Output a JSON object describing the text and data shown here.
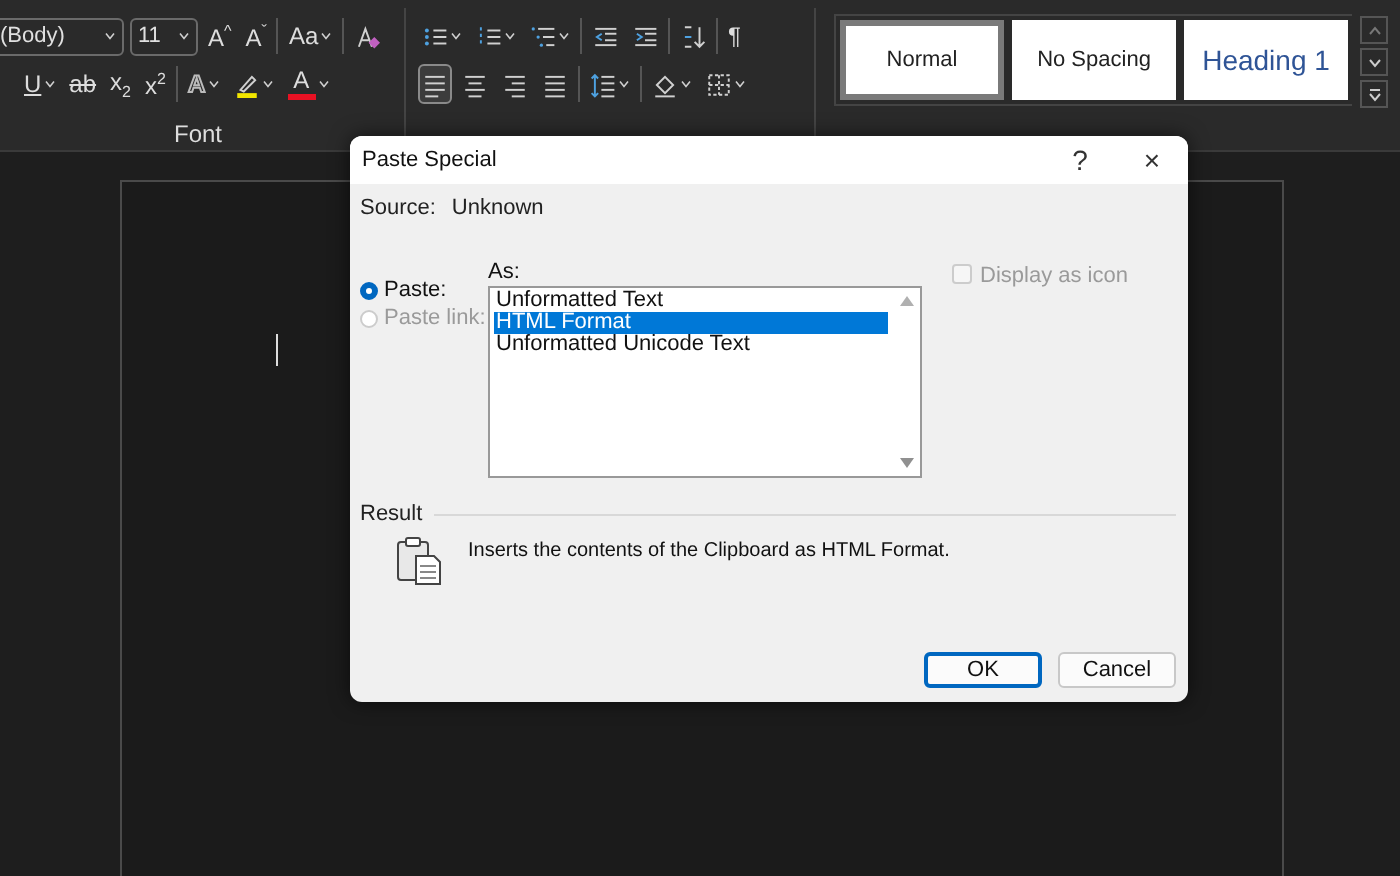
{
  "ribbon": {
    "font": {
      "name": "(Body)",
      "size": "11",
      "label": "Font",
      "row1": [
        {
          "kind": "glyph",
          "text": "A$^{^}$",
          "menu": false
        },
        {
          "kind": "glyph",
          "text": "A$^{ˇ}$",
          "menu": false
        },
        {
          "kind": "sep"
        },
        {
          "kind": "glyph",
          "text": "Aa",
          "menu": true
        },
        {
          "kind": "sep"
        },
        {
          "kind": "clear-format",
          "menu": false
        }
      ],
      "row2": [
        {
          "kind": "underline",
          "text": "U",
          "menu": true
        },
        {
          "kind": "strike",
          "text": "ab",
          "menu": false
        },
        {
          "kind": "glyph",
          "text": "x$_{2}$",
          "menu": false
        },
        {
          "kind": "glyph",
          "text": "x$^{2}$",
          "menu": false
        },
        {
          "kind": "sep"
        },
        {
          "kind": "effects",
          "text": "A",
          "menu": true
        },
        {
          "kind": "highlight",
          "menu": true
        },
        {
          "kind": "font-color",
          "text": "A",
          "menu": true
        }
      ]
    },
    "paragraph": {
      "row1": [
        {
          "kind": "bullets",
          "menu": true
        },
        {
          "kind": "numbering",
          "menu": true
        },
        {
          "kind": "multilevel",
          "menu": true
        },
        {
          "kind": "sep"
        },
        {
          "kind": "outdent",
          "menu": false
        },
        {
          "kind": "indent",
          "menu": false
        },
        {
          "kind": "sep"
        },
        {
          "kind": "sort",
          "menu": false
        },
        {
          "kind": "sep"
        },
        {
          "kind": "glyph",
          "text": "¶",
          "menu": false
        }
      ],
      "row2": [
        {
          "kind": "align-left",
          "selected": true,
          "menu": false
        },
        {
          "kind": "align-center",
          "selected": false,
          "menu": false
        },
        {
          "kind": "align-right",
          "selected": false,
          "menu": false
        },
        {
          "kind": "justify",
          "selected": false,
          "menu": false
        },
        {
          "kind": "sep"
        },
        {
          "kind": "line-spacing",
          "menu": true
        },
        {
          "kind": "sep"
        },
        {
          "kind": "shading",
          "menu": true
        },
        {
          "kind": "borders",
          "menu": true
        }
      ]
    },
    "styles": [
      {
        "label": "Normal",
        "kind": "normal",
        "selected": true
      },
      {
        "label": "No Spacing",
        "kind": "normal",
        "selected": false
      },
      {
        "label": "Heading 1",
        "kind": "heading",
        "selected": false
      }
    ]
  },
  "dialog": {
    "title": "Paste Special",
    "help": "?",
    "close": "×",
    "source_label": "Source:",
    "source": "Unknown",
    "as_label": "As:",
    "options": [
      {
        "label": "Paste:",
        "selected": true,
        "disabled": false
      },
      {
        "label": "Paste link:",
        "selected": false,
        "disabled": true
      }
    ],
    "formats": [
      {
        "label": "Unformatted Text",
        "selected": false
      },
      {
        "label": "HTML Format",
        "selected": true
      },
      {
        "label": "Unformatted Unicode Text",
        "selected": false
      }
    ],
    "display_as_icon": {
      "label": "Display as icon",
      "checked": false,
      "disabled": true
    },
    "result_label": "Result",
    "result_text": "Inserts the contents of the Clipboard as HTML Format.",
    "buttons": [
      {
        "label": "OK",
        "default": true
      },
      {
        "label": "Cancel",
        "default": false
      }
    ]
  }
}
